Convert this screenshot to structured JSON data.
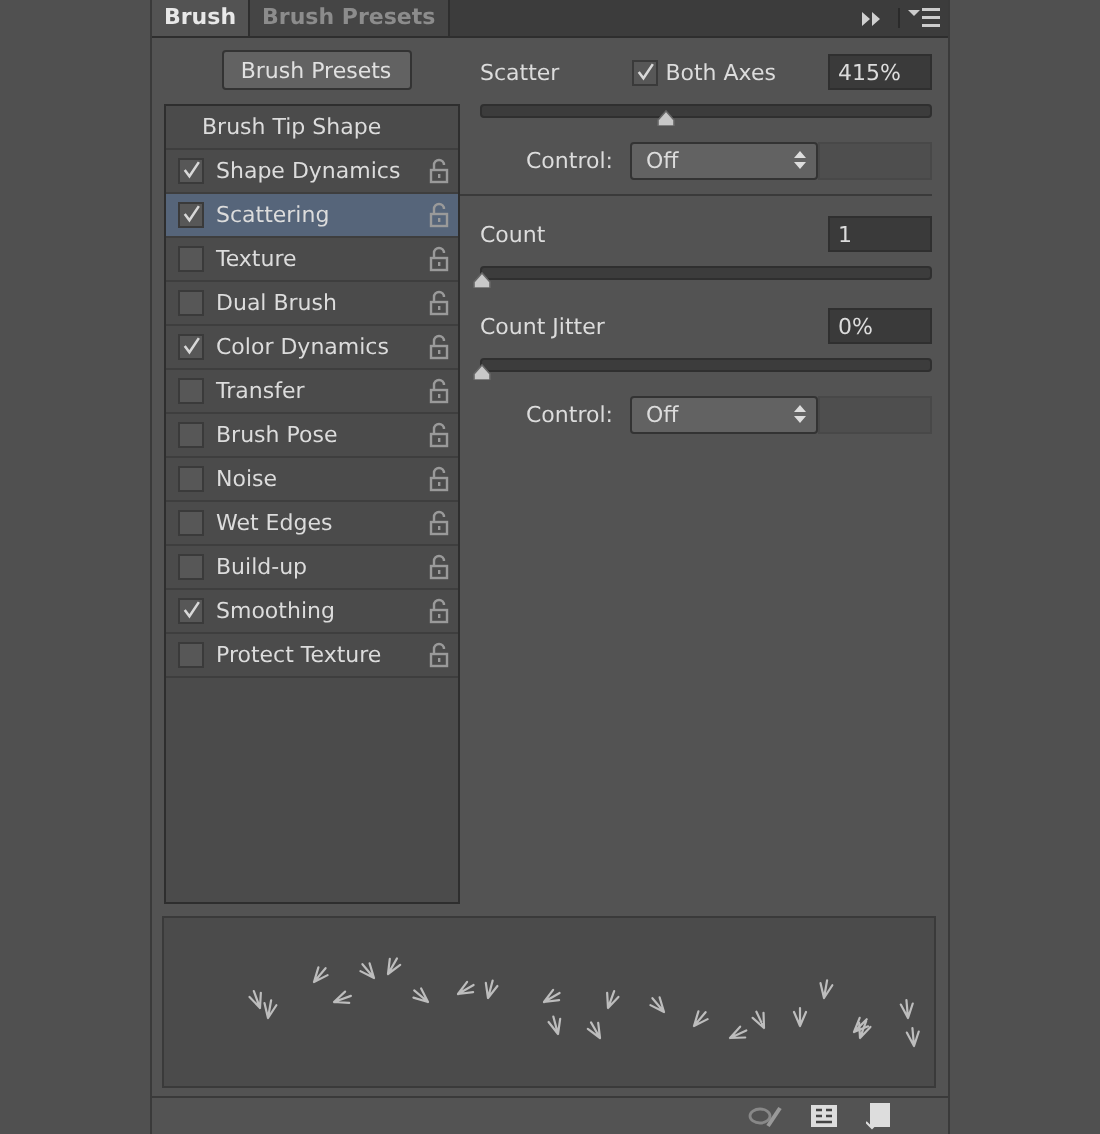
{
  "tabs": [
    {
      "label": "Brush",
      "selected": true
    },
    {
      "label": "Brush Presets",
      "selected": false
    }
  ],
  "presets_button": "Brush Presets",
  "options": [
    {
      "kind": "header",
      "label": "Brush Tip Shape",
      "selected": false
    },
    {
      "kind": "option",
      "label": "Shape Dynamics",
      "checked": true,
      "selected": false
    },
    {
      "kind": "option",
      "label": "Scattering",
      "checked": true,
      "selected": true
    },
    {
      "kind": "option",
      "label": "Texture",
      "checked": false,
      "selected": false
    },
    {
      "kind": "option",
      "label": "Dual Brush",
      "checked": false,
      "selected": false
    },
    {
      "kind": "option",
      "label": "Color Dynamics",
      "checked": true,
      "selected": false
    },
    {
      "kind": "option",
      "label": "Transfer",
      "checked": false,
      "selected": false
    },
    {
      "kind": "option",
      "label": "Brush Pose",
      "checked": false,
      "selected": false
    },
    {
      "kind": "option",
      "label": "Noise",
      "checked": false,
      "selected": false
    },
    {
      "kind": "option",
      "label": "Wet Edges",
      "checked": false,
      "selected": false
    },
    {
      "kind": "option",
      "label": "Build-up",
      "checked": false,
      "selected": false
    },
    {
      "kind": "option",
      "label": "Smoothing",
      "checked": true,
      "selected": false
    },
    {
      "kind": "option",
      "label": "Protect Texture",
      "checked": false,
      "selected": false
    }
  ],
  "settings": [
    {
      "kind": "slider",
      "label": "Scatter",
      "checkbox": {
        "label": "Both Axes",
        "checked": true
      },
      "value": "415%",
      "level": 0.41
    },
    {
      "kind": "control",
      "label": "Control:",
      "value": "Off"
    },
    {
      "kind": "divider"
    },
    {
      "kind": "slider",
      "label": "Count",
      "value": "1",
      "level": 0
    },
    {
      "kind": "slider",
      "label": "Count Jitter",
      "value": "0%",
      "level": 0
    },
    {
      "kind": "control",
      "label": "Control:",
      "value": "Off"
    }
  ]
}
